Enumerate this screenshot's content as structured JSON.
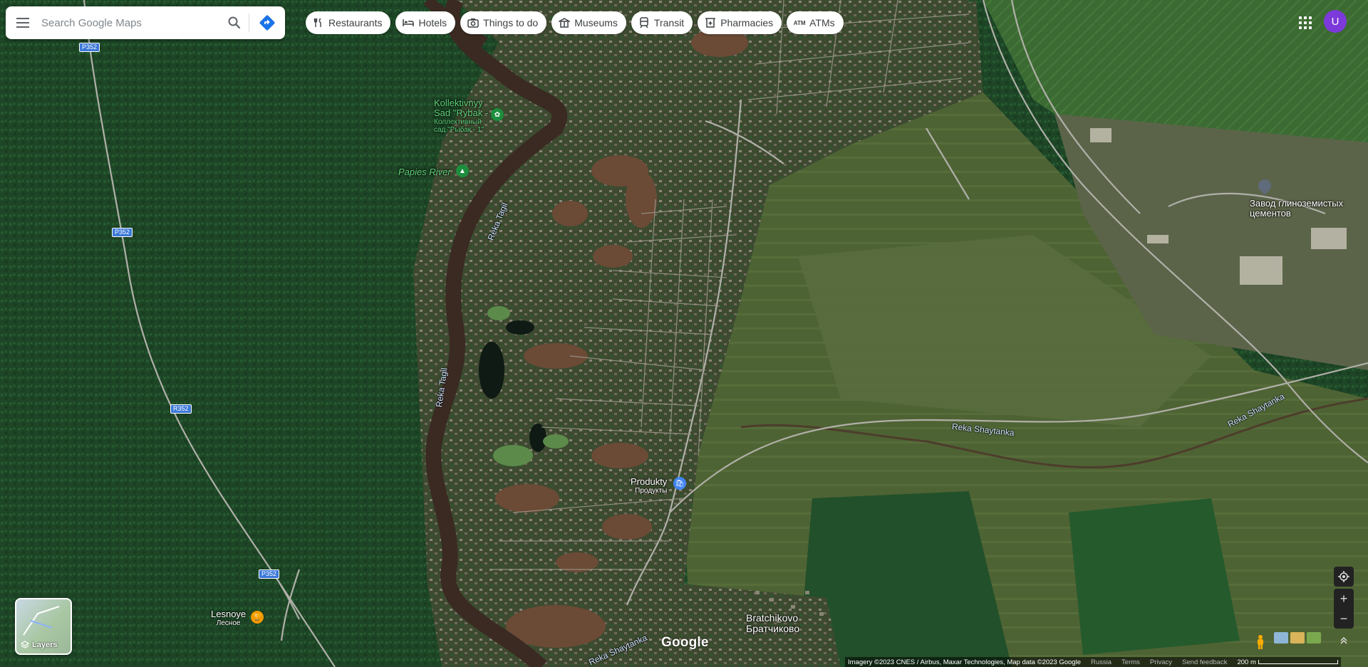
{
  "search": {
    "placeholder": "Search Google Maps"
  },
  "chips": [
    {
      "label": "Restaurants",
      "icon": "fork-knife-icon"
    },
    {
      "label": "Hotels",
      "icon": "bed-icon"
    },
    {
      "label": "Things to do",
      "icon": "camera-icon"
    },
    {
      "label": "Museums",
      "icon": "museum-icon"
    },
    {
      "label": "Transit",
      "icon": "train-icon"
    },
    {
      "label": "Pharmacies",
      "icon": "pharmacy-icon"
    },
    {
      "label": "ATMs",
      "icon": "atm-icon"
    }
  ],
  "account": {
    "initial": "U",
    "color": "#7b3ad9"
  },
  "map": {
    "road_shields": [
      "Р352",
      "Р352",
      "R352",
      "Р352"
    ],
    "places": [
      {
        "name": "Kollektivnyy",
        "name2": "Sad \"Rybak - 1\"",
        "local": "Коллективный",
        "local2": "сад \"Рыбак - 1\""
      },
      {
        "name": "Papies River"
      },
      {
        "name": "Завод глиноземистых",
        "name2": "цементов"
      },
      {
        "name": "Produkty",
        "local": "Продукты"
      },
      {
        "name": "Lesnoye",
        "local": "Лесное"
      },
      {
        "name": "Bratchikovo",
        "local": "Братчиково"
      }
    ],
    "rivers": [
      "Reka Tagil",
      "Reka Tagil",
      "Reka Shaytanka",
      "Reka Shaytanka",
      "Reka Shaytanka"
    ],
    "water_color": "#4a2f22",
    "forest_color": "#1f4a25",
    "field_color": "#5d6e3a"
  },
  "layers": {
    "label": "Layers"
  },
  "brand": "Google",
  "footer": {
    "attribution": "Imagery ©2023 CNES / Airbus, Maxar Technologies, Map data ©2023 Google",
    "links": [
      "Russia",
      "Terms",
      "Privacy",
      "Send feedback"
    ],
    "scale": "200 m"
  },
  "controls": {
    "zoom_in": "+",
    "zoom_out": "−"
  }
}
